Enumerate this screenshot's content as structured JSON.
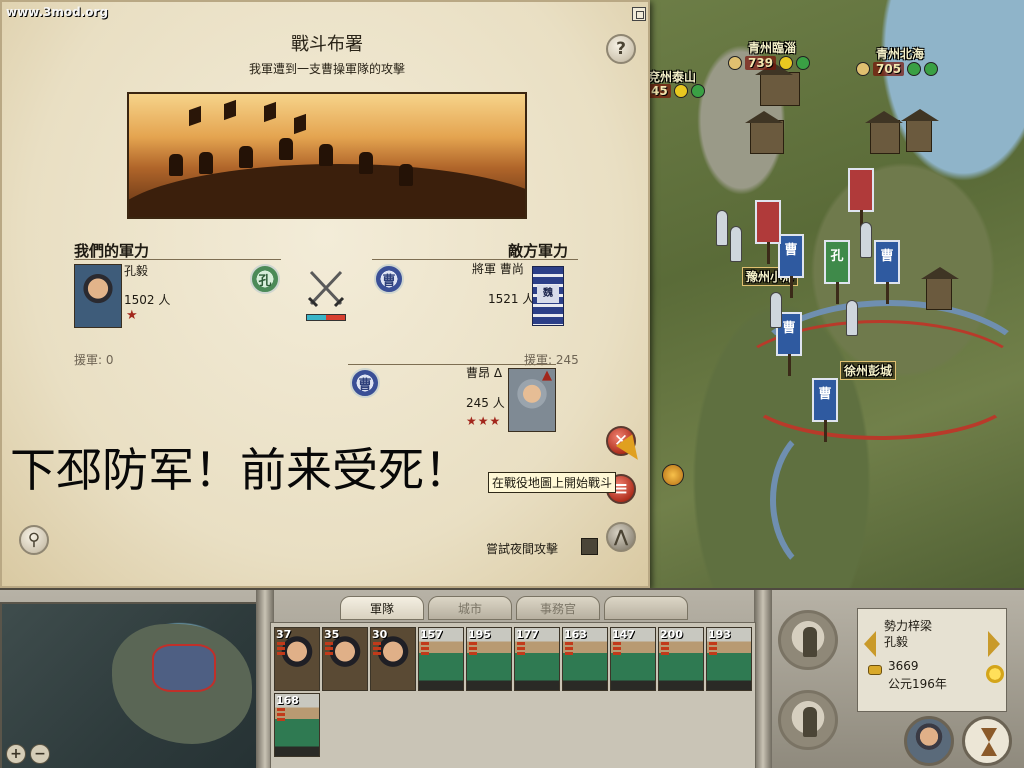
{
  "watermark": "www.3mod.org",
  "deploy": {
    "title": "戰斗布署",
    "subtitle": "我軍遭到一支曹操軍隊的攻擊",
    "ally": {
      "heading": "我們的軍力",
      "general": "孔毅",
      "men": "1502 人",
      "reinforcements": "援軍: 0",
      "badge": "孔"
    },
    "enemy": {
      "heading": "敵方軍力",
      "general": "將軍 曹尚",
      "men": "1521 人",
      "reinforcements": "援軍: 245",
      "badge": "曹",
      "banner": "魏"
    },
    "reinforcement": {
      "general": "曹昂 Δ",
      "men": "245 人",
      "stars": "★★★",
      "badge": "曹"
    },
    "tooltip": "在戰役地圖上開始戰斗",
    "night_attack": "嘗試夜間攻擊",
    "caption": "下邳防军！前来受死！",
    "help_icon": "?",
    "strength_ratio": {
      "ally": 0.5,
      "enemy": 0.5
    }
  },
  "map": {
    "settlements": [
      {
        "name": "青州臨淄",
        "population": "739"
      },
      {
        "name": "青州北海",
        "population": "705"
      },
      {
        "name": "兗州泰山",
        "population": "45"
      },
      {
        "name": "豫州小沛"
      },
      {
        "name": "徐州彭城"
      }
    ],
    "banner_labels": [
      "曹",
      "曹",
      "曹",
      "曹",
      "孔"
    ]
  },
  "hud": {
    "tabs": [
      {
        "label": "軍隊",
        "active": true
      },
      {
        "label": "城市",
        "active": false
      },
      {
        "label": "事務官",
        "active": false
      },
      {
        "label": "",
        "active": false
      }
    ],
    "units": [
      {
        "count": "37",
        "kind": "general"
      },
      {
        "count": "35",
        "kind": "general"
      },
      {
        "count": "30",
        "kind": "general"
      },
      {
        "count": "157",
        "kind": "soldier"
      },
      {
        "count": "195",
        "kind": "soldier"
      },
      {
        "count": "177",
        "kind": "soldier"
      },
      {
        "count": "163",
        "kind": "soldier"
      },
      {
        "count": "147",
        "kind": "soldier"
      },
      {
        "count": "200",
        "kind": "soldier"
      },
      {
        "count": "193",
        "kind": "soldier"
      },
      {
        "count": "168",
        "kind": "soldier"
      }
    ],
    "faction": {
      "name": "勢力梓梁",
      "leader": "孔毅",
      "gold": "3669",
      "year": "公元196年"
    },
    "zoom_in": "+",
    "zoom_out": "−"
  }
}
